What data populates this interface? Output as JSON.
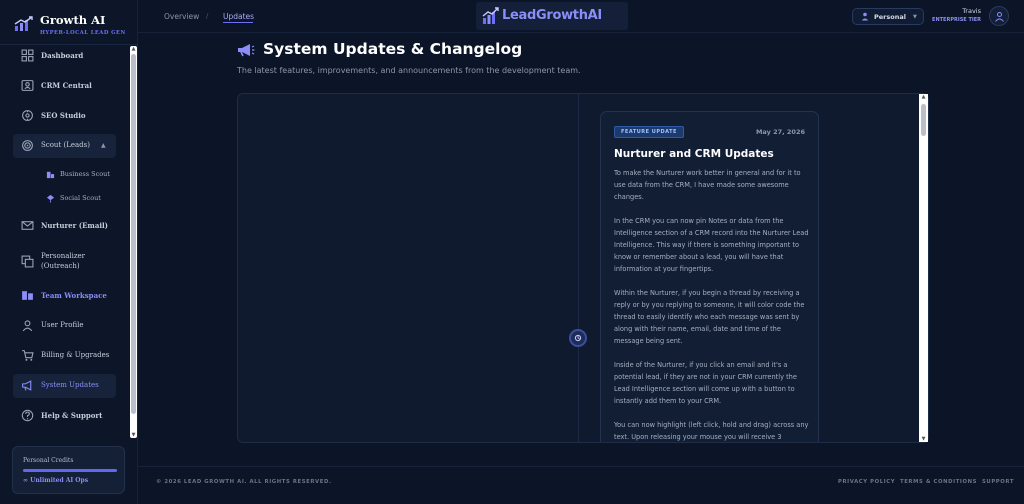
{
  "brand": {
    "name": "Growth AI",
    "tagline": "HYPER-LOCAL LEAD GEN"
  },
  "sidebar": {
    "items": [
      {
        "label": "Dashboard",
        "icon": "grid-icon"
      },
      {
        "label": "CRM Central",
        "icon": "contact-card-icon"
      },
      {
        "label": "SEO Studio",
        "icon": "globe-icon"
      },
      {
        "label": "Scout (Leads)",
        "icon": "target-icon"
      },
      {
        "label": "Nurturer (Email)",
        "icon": "mail-icon"
      },
      {
        "label": "Personalizer (Outreach)",
        "icon": "copy-icon"
      },
      {
        "label": "Team Workspace",
        "icon": "team-icon"
      },
      {
        "label": "User Profile",
        "icon": "user-icon"
      },
      {
        "label": "Billing & Upgrades",
        "icon": "cart-icon"
      },
      {
        "label": "System Updates",
        "icon": "megaphone-icon"
      },
      {
        "label": "Help & Support",
        "icon": "help-icon"
      }
    ],
    "subitems": [
      {
        "label": "Business Scout",
        "icon": "building-icon"
      },
      {
        "label": "Social Scout",
        "icon": "social-icon"
      }
    ],
    "credits": {
      "title": "Personal Credits",
      "subtitle": "∞ Unlimited AI Ops",
      "fill": 1.0
    }
  },
  "topbar": {
    "breadcrumb": [
      "Overview",
      "Updates"
    ],
    "logo_text": "LeadGrowthAI",
    "workspace": "Personal",
    "user_name": "Travis",
    "user_tier": "ENTERPRISE TIER"
  },
  "main": {
    "title": "System Updates & Changelog",
    "subtitle": "The latest features, improvements, and announcements from the development team.",
    "update": {
      "badge": "FEATURE UPDATE",
      "date": "May 27, 2026",
      "title": "Nurturer and CRM Updates",
      "paragraphs": [
        "To make the Nurturer work better in general and for it to use data from the CRM, I have made some awesome changes.",
        "In the CRM you can now pin Notes or data from the Intelligence section of a CRM record into the Nurturer Lead Intelligence. This way if there is something important to know or remember about a lead, you will have that information at your fingertips.",
        "Within the Nurturer, if you begin a thread by receiving a reply or by you replying to someone, it will color code the thread to easily identify who each message was sent by along with their name, email, date and time of the message being sent.",
        "Inside of the Nurturer, if you click an email and it's a potential lead, if they are not in your CRM currently the Lead Intelligence section will come up with a button to instantly add them to your CRM.",
        "You can now highlight (left click, hold and drag) across any text. Upon releasing your mouse you will receive 3"
      ]
    }
  },
  "footer": {
    "copyright": "© 2026 LEAD GROWTH AI. ALL RIGHTS RESERVED.",
    "links": [
      "PRIVACY POLICY",
      "TERMS & CONDITIONS",
      "SUPPORT"
    ]
  },
  "colors": {
    "accent": "#6d6ff5",
    "background": "#0b1527",
    "badge": "#1d3a6e"
  }
}
